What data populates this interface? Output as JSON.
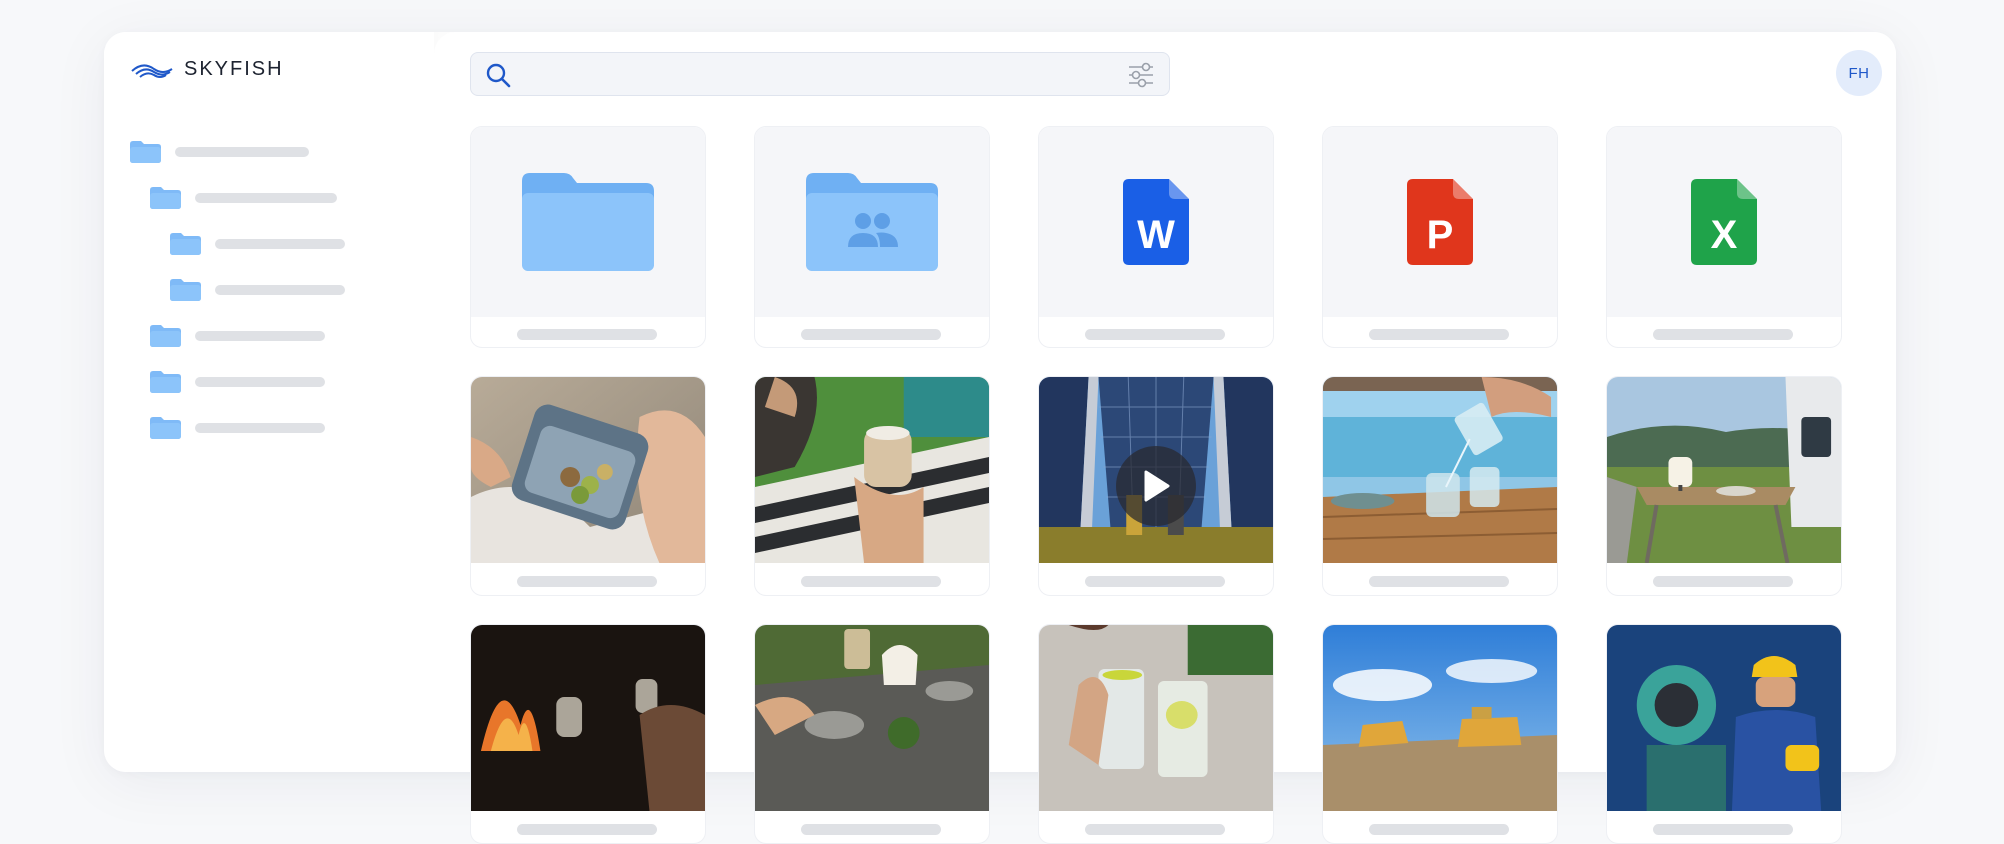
{
  "app": {
    "brand": "SKYFISH"
  },
  "search": {
    "value": "",
    "placeholder": ""
  },
  "user": {
    "initials": "FH"
  },
  "colors": {
    "brand_blue": "#1f58c9",
    "folder": "#7fbaf7",
    "word": "#1a5fe6",
    "powerpoint": "#e0361c",
    "excel": "#1fa34a"
  },
  "sidebar": {
    "folders": [
      {
        "level": 0
      },
      {
        "level": 1
      },
      {
        "level": 2
      },
      {
        "level": 2
      },
      {
        "level": 1
      },
      {
        "level": 1
      },
      {
        "level": 1
      }
    ]
  },
  "grid": {
    "row1": [
      {
        "kind": "folder",
        "icon": "folder-icon"
      },
      {
        "kind": "shared-folder",
        "icon": "shared-folder-icon"
      },
      {
        "kind": "file",
        "icon": "word-file-icon",
        "letter": "W"
      },
      {
        "kind": "file",
        "icon": "powerpoint-file-icon",
        "letter": "P"
      },
      {
        "kind": "file",
        "icon": "excel-file-icon",
        "letter": "X"
      }
    ],
    "row2": [
      {
        "kind": "image",
        "subject": "snack-box-photo"
      },
      {
        "kind": "image",
        "subject": "coffee-lounger-photo"
      },
      {
        "kind": "video",
        "subject": "solar-panels-video",
        "icon": "play-icon"
      },
      {
        "kind": "image",
        "subject": "pouring-water-photo"
      },
      {
        "kind": "image",
        "subject": "camper-table-photo"
      }
    ],
    "row3": [
      {
        "kind": "image",
        "subject": "fireplace-wine-photo"
      },
      {
        "kind": "image",
        "subject": "outdoor-dinner-photo"
      },
      {
        "kind": "image",
        "subject": "drinks-photo"
      },
      {
        "kind": "image",
        "subject": "mining-trucks-photo"
      },
      {
        "kind": "image",
        "subject": "industrial-worker-photo"
      }
    ]
  }
}
